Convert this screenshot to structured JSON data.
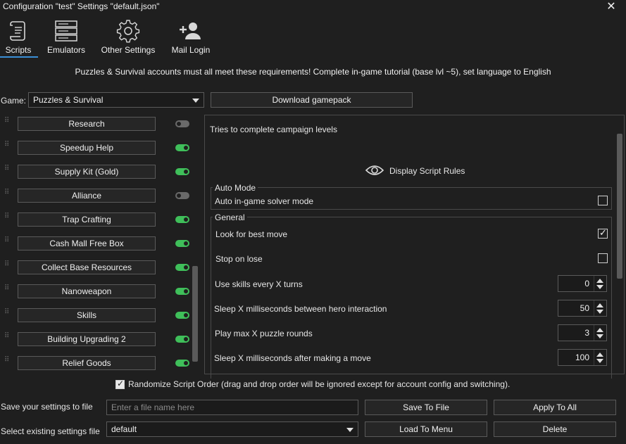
{
  "window": {
    "title": "Configuration \"test\" Settings \"default.json\"",
    "close_glyph": "✕"
  },
  "tabs": [
    {
      "label": "Scripts",
      "icon": "scroll-icon",
      "active": true
    },
    {
      "label": "Emulators",
      "icon": "server-icon"
    },
    {
      "label": "Other Settings",
      "icon": "gear-icon"
    },
    {
      "label": "Mail Login",
      "icon": "add-user-icon"
    }
  ],
  "banner": "Puzzles & Survival accounts must all meet these requirements! Complete in-game tutorial (base lvl ~5), set language to English",
  "game": {
    "label": "Game:",
    "selected": "Puzzles & Survival",
    "download_label": "Download gamepack"
  },
  "scripts": [
    {
      "label": "Research",
      "enabled": false
    },
    {
      "label": "Speedup Help",
      "enabled": true
    },
    {
      "label": "Supply Kit (Gold)",
      "enabled": true
    },
    {
      "label": "Alliance",
      "enabled": false
    },
    {
      "label": "Trap Crafting",
      "enabled": true
    },
    {
      "label": "Cash Mall Free Box",
      "enabled": true
    },
    {
      "label": "Collect Base Resources",
      "enabled": true
    },
    {
      "label": "Nanoweapon",
      "enabled": true
    },
    {
      "label": "Skills",
      "enabled": true
    },
    {
      "label": "Building Upgrading 2",
      "enabled": true
    },
    {
      "label": "Relief Goods",
      "enabled": true
    }
  ],
  "details": {
    "description": "Tries to complete campaign levels",
    "rules_label": "Display Script Rules",
    "auto_mode": {
      "title": "Auto Mode",
      "option": {
        "label": "Auto in-game solver mode",
        "checked": false
      }
    },
    "general": {
      "title": "General",
      "checks": [
        {
          "label": "Look for best move",
          "checked": true
        },
        {
          "label": "Stop on lose",
          "checked": false
        }
      ],
      "spins": [
        {
          "label": "Use skills every X turns",
          "value": "0"
        },
        {
          "label": "Sleep X milliseconds between hero interaction",
          "value": "50"
        },
        {
          "label": "Play max X puzzle rounds",
          "value": "3"
        },
        {
          "label": "Sleep X milliseconds after making a move",
          "value": "100"
        }
      ]
    }
  },
  "bottom": {
    "randomize_label": "Randomize Script Order (drag and drop order will be ignored except for account config and switching).",
    "save_label": "Save your settings to file",
    "file_placeholder": "Enter a file name here",
    "save_button": "Save To File",
    "apply_button": "Apply To All",
    "select_label": "Select existing settings file",
    "selected_file": "default",
    "load_button": "Load To Menu",
    "delete_button": "Delete"
  }
}
